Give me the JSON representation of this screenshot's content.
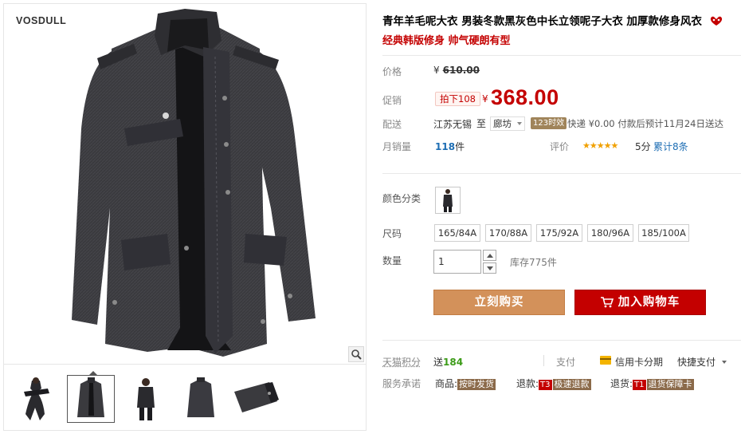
{
  "gallery": {
    "brand": "VOSDULL",
    "thumbnails": [
      "thumb-model-scarf",
      "thumb-coat-front",
      "thumb-model-front",
      "thumb-coat-back",
      "thumb-sleeve-detail"
    ],
    "active_thumbnail": 1
  },
  "product": {
    "title": "青年羊毛呢大衣 男装冬款黑灰色中长立领呢子大衣 加厚款修身风衣",
    "subtitle": "经典韩版修身 帅气硬朗有型",
    "badge_icon": "tmall-badge-icon"
  },
  "price": {
    "label": "价格",
    "currency": "¥",
    "original": "610.00"
  },
  "promo": {
    "label": "促销",
    "tag": "拍下108",
    "currency": "¥",
    "price": "368.00"
  },
  "shipping": {
    "label": "配送",
    "from": "江苏无锡",
    "to_word": "至",
    "to_city": "廊坊",
    "time_badge": "123时效",
    "detail": "快递 ¥0.00 付款后预计11月24日送达"
  },
  "sales": {
    "label": "月销量",
    "count": "118",
    "unit": "件",
    "rating_label": "评价",
    "stars": "★★★★★",
    "score": "5分",
    "reviews": "累计8条"
  },
  "options": {
    "color_label": "颜色分类",
    "size_label": "尺码",
    "sizes": [
      "165/84A",
      "170/88A",
      "175/92A",
      "180/96A",
      "185/100A"
    ],
    "qty_label": "数量",
    "qty_value": "1",
    "stock": "库存775件"
  },
  "actions": {
    "buy_now": "立刻购买",
    "add_to_cart": "加入购物车"
  },
  "footer": {
    "points_label": "天猫积分",
    "points_prefix": "送",
    "points_value": "184",
    "pay_label": "支付",
    "credit": "信用卡分期",
    "quickpay": "快捷支付",
    "service_label": "服务承诺",
    "svc1_prefix": "商品:",
    "svc1_tag": "按时发货",
    "svc2_prefix": "退款:",
    "svc2_code": "T3",
    "svc2_tag": "极速退款",
    "svc3_prefix": "退货:",
    "svc3_code": "T1",
    "svc3_tag": "退货保障卡"
  },
  "colors": {
    "accent_red": "#c40000",
    "buy_orange": "#d3915a",
    "link_blue": "#1e6eb4",
    "star_gold": "#f0a000",
    "points_green": "#3c9b18"
  }
}
